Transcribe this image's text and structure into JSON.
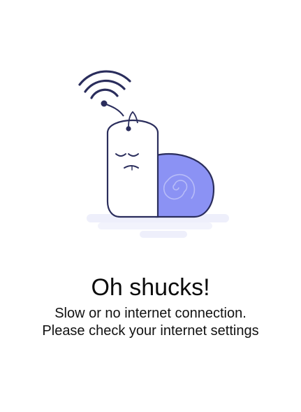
{
  "error_screen": {
    "title": "Oh shucks!",
    "message_line_1": "Slow or no internet connection.",
    "message_line_2": "Please check your internet settings"
  },
  "illustration": {
    "icons": [
      "wifi-signal-icon",
      "snail-illustration"
    ],
    "colors": {
      "outline": "#2a2d5c",
      "shell": "#8b92f4",
      "shell_spiral": "#b7bcf8",
      "body": "#ffffff",
      "shadow": "#eeeffb"
    }
  }
}
